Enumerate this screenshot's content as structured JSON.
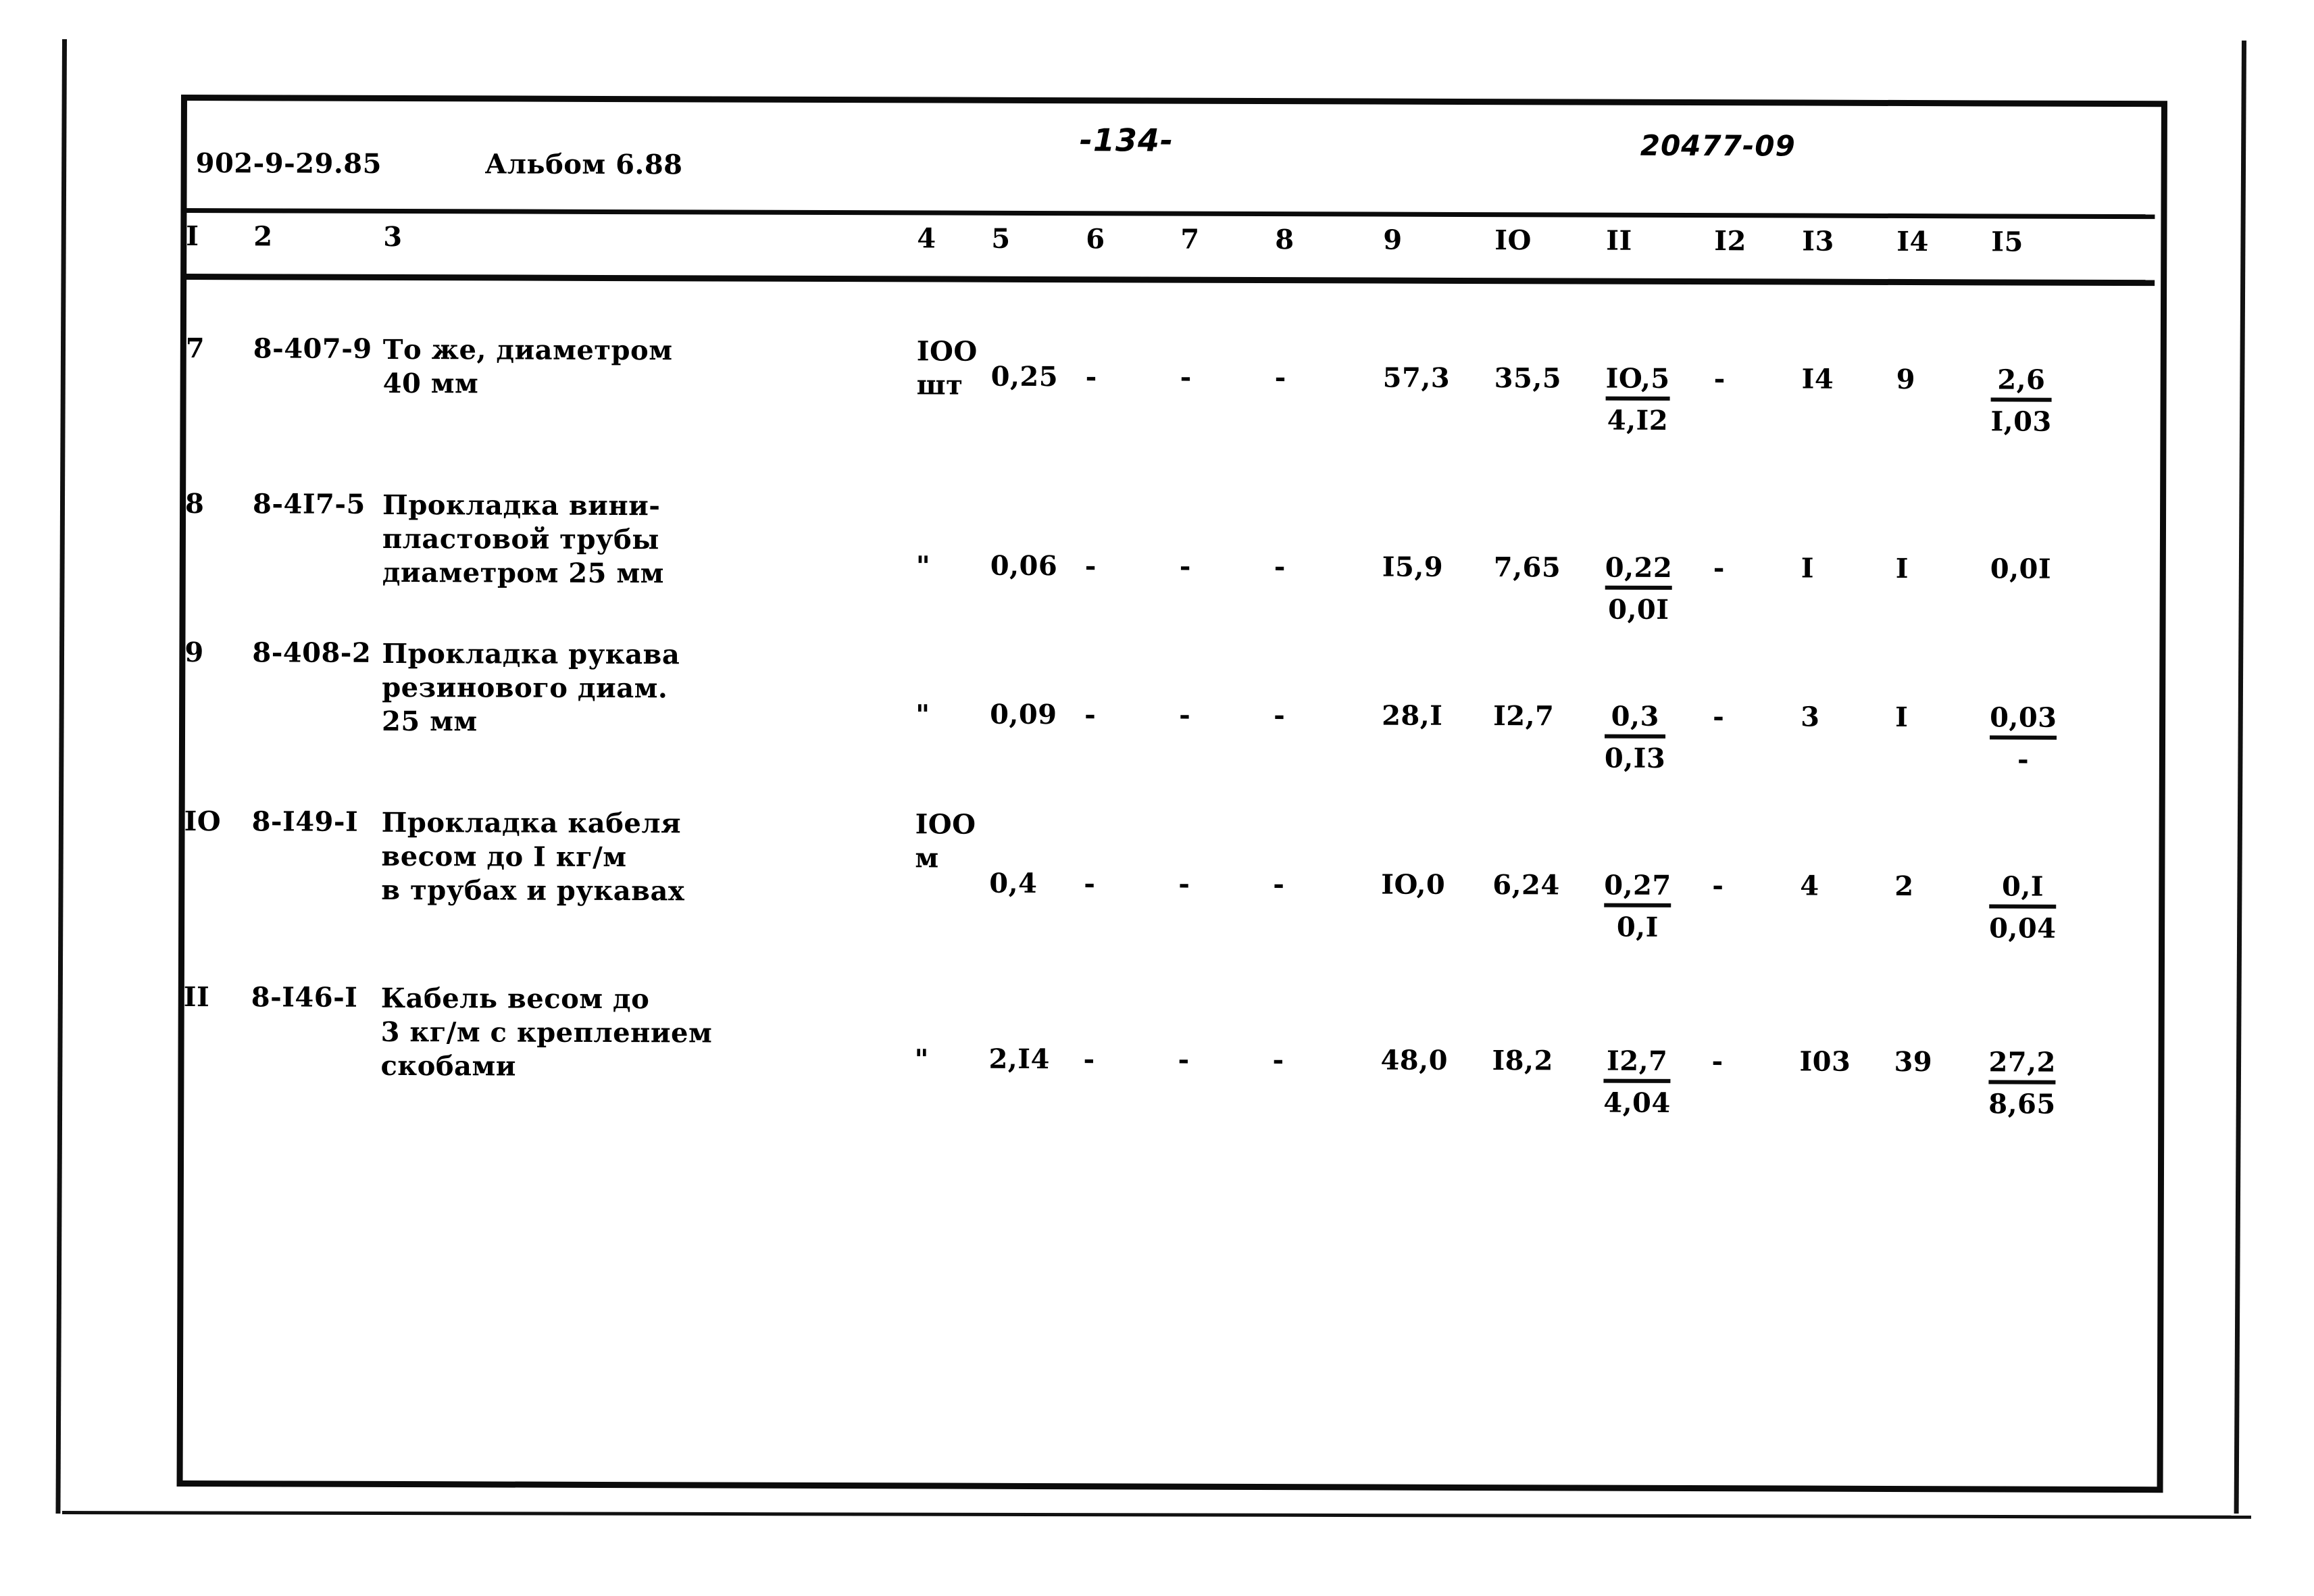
{
  "header": {
    "doc_code": "902-9-29.85",
    "album_label": "Альбом 6.88",
    "page_number": "-134-",
    "sheet_code": "20477-09"
  },
  "table": {
    "column_headers": [
      "I",
      "2",
      "3",
      "4",
      "5",
      "6",
      "7",
      "8",
      "9",
      "IO",
      "II",
      "I2",
      "I3",
      "I4",
      "I5"
    ],
    "rows": [
      {
        "no": "7",
        "code": "8-407-9",
        "description": [
          "То же, диаметром",
          "40 мм"
        ],
        "unit": [
          "IOO",
          "шт"
        ],
        "c5": "0,25",
        "c6": "-",
        "c7": "-",
        "c8": "-",
        "c9": "57,3",
        "c10": "35,5",
        "c11_num": "IO,5",
        "c11_den": "4,I2",
        "c12": "-",
        "c13": "I4",
        "c14": "9",
        "c15_num": "2,6",
        "c15_den": "I,03"
      },
      {
        "no": "8",
        "code": "8-4I7-5",
        "description": [
          "Прокладка вини-",
          "пластовой трубы",
          "диаметром 25 мм"
        ],
        "unit": [
          "\""
        ],
        "c5": "0,06",
        "c6": "-",
        "c7": "-",
        "c8": "-",
        "c9": "I5,9",
        "c10": "7,65",
        "c11_num": "0,22",
        "c11_den": "0,0I",
        "c12": "-",
        "c13": "I",
        "c14": "I",
        "c15_num": "0,0I",
        "c15_den": ""
      },
      {
        "no": "9",
        "code": "8-408-2",
        "description": [
          "Прокладка рукава",
          "резинового диам.",
          "25 мм"
        ],
        "unit": [
          "\""
        ],
        "c5": "0,09",
        "c6": "-",
        "c7": "-",
        "c8": "-",
        "c9": "28,I",
        "c10": "I2,7",
        "c11_num": "0,3",
        "c11_den": "0,I3",
        "c12": "-",
        "c13": "3",
        "c14": "I",
        "c15_num": "0,03",
        "c15_den": "-"
      },
      {
        "no": "IO",
        "code": "8-I49-I",
        "description": [
          "Прокладка кабеля",
          "весом до I кг/м",
          "в трубах и рукавах"
        ],
        "unit": [
          "IOO",
          "м"
        ],
        "c5": "0,4",
        "c6": "-",
        "c7": "-",
        "c8": "-",
        "c9": "IO,0",
        "c10": "6,24",
        "c11_num": "0,27",
        "c11_den": "0,I",
        "c12": "-",
        "c13": "4",
        "c14": "2",
        "c15_num": "0,I",
        "c15_den": "0,04"
      },
      {
        "no": "II",
        "code": "8-I46-I",
        "description": [
          "Кабель весом до",
          "3 кг/м с креплением",
          "скобами"
        ],
        "unit": [
          "\""
        ],
        "c5": "2,I4",
        "c6": "-",
        "c7": "-",
        "c8": "-",
        "c9": "48,0",
        "c10": "I8,2",
        "c11_num": "I2,7",
        "c11_den": "4,04",
        "c12": "-",
        "c13": "I03",
        "c14": "39",
        "c15_num": "27,2",
        "c15_den": "8,65"
      }
    ]
  },
  "layout": {
    "col_x": [
      8,
      108,
      300,
      1090,
      1200,
      1340,
      1480,
      1620,
      1780,
      1945,
      2110,
      2270,
      2400,
      2540,
      2680
    ],
    "row_top": [
      70,
      300,
      520,
      770,
      1030
    ],
    "row_num_offset": [
      0,
      0,
      0,
      0,
      0
    ],
    "value_line_offset": [
      38,
      88,
      88,
      88,
      88
    ]
  }
}
